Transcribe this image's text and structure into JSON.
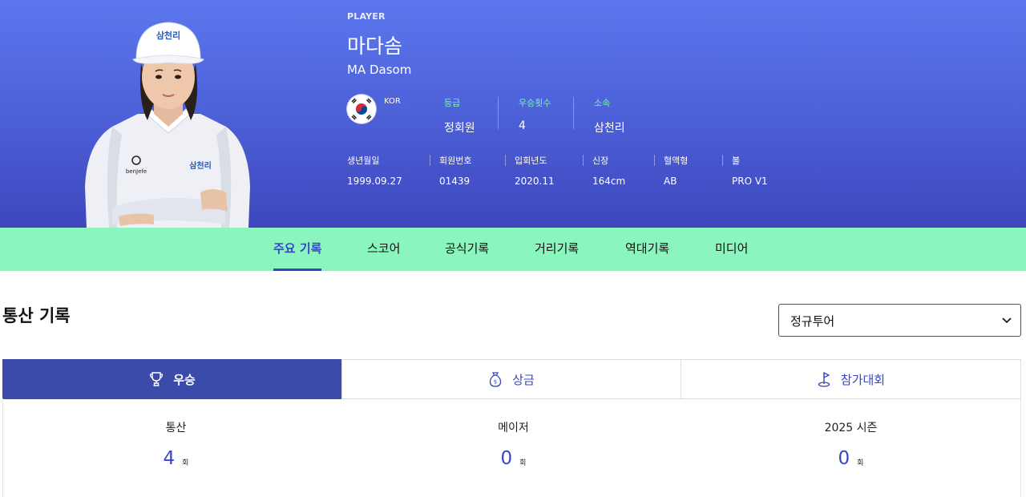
{
  "player": {
    "tag": "PLAYER",
    "name_ko": "마다솜",
    "name_en": "MA Dasom",
    "nation": "KOR",
    "cap_text": "삼천리",
    "shirt_sponsor": "삼천리",
    "shirt_brand": "benJefe"
  },
  "stats": [
    {
      "label": "등급",
      "value": "정회원"
    },
    {
      "label": "우승횟수",
      "value": "4"
    },
    {
      "label": "소속",
      "value": "삼천리"
    }
  ],
  "info": [
    {
      "label": "생년월일",
      "value": "1999.09.27"
    },
    {
      "label": "회원번호",
      "value": "01439"
    },
    {
      "label": "입회년도",
      "value": "2020.11"
    },
    {
      "label": "신장",
      "value": "164cm"
    },
    {
      "label": "혈액형",
      "value": "AB"
    },
    {
      "label": "볼",
      "value": "PRO V1"
    }
  ],
  "tabs": [
    "주요 기록",
    "스코어",
    "공식기록",
    "거리기록",
    "역대기록",
    "미디어"
  ],
  "active_tab": "주요 기록",
  "section": {
    "title": "통산 기록",
    "dropdown_value": "정규투어"
  },
  "record_tabs": [
    {
      "label": "우승",
      "icon": "trophy-icon"
    },
    {
      "label": "상금",
      "icon": "money-bag-icon"
    },
    {
      "label": "참가대회",
      "icon": "golf-flag-icon"
    }
  ],
  "records": [
    {
      "label": "통산",
      "value": "4",
      "unit": "회"
    },
    {
      "label": "메이저",
      "value": "0",
      "unit": "회"
    },
    {
      "label": "2025 시즌",
      "value": "0",
      "unit": "회"
    }
  ],
  "colors": {
    "hero_top": "#5c77ee",
    "hero_bottom": "#3f47bd",
    "tab_bar": "#8af5bd",
    "accent": "#3846c4",
    "active_record_tab": "#3a4baa",
    "stat_label": "#7ff0bf"
  }
}
